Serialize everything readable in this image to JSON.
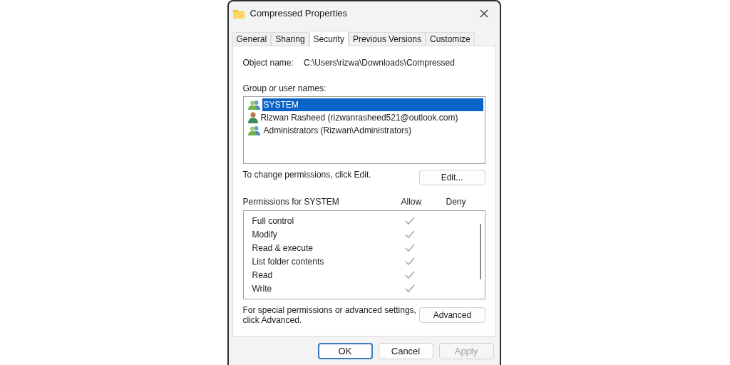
{
  "window": {
    "title": "Compressed Properties"
  },
  "tabs": [
    {
      "label": "General",
      "selected": false
    },
    {
      "label": "Sharing",
      "selected": false
    },
    {
      "label": "Security",
      "selected": true
    },
    {
      "label": "Previous Versions",
      "selected": false
    },
    {
      "label": "Customize",
      "selected": false
    }
  ],
  "object_name": {
    "label": "Object name:",
    "value": "C:\\Users\\rizwa\\Downloads\\Compressed"
  },
  "users": {
    "label": "Group or user names:",
    "items": [
      {
        "name": "SYSTEM",
        "kind": "group",
        "selected": true
      },
      {
        "name": "Rizwan Rasheed (rizwanrasheed521@outlook.com)",
        "kind": "user",
        "selected": false
      },
      {
        "name": "Administrators (Rizwan\\Administrators)",
        "kind": "group",
        "selected": false
      }
    ]
  },
  "edit_hint": "To change permissions, click Edit.",
  "edit_button": "Edit...",
  "permissions": {
    "label": "Permissions for SYSTEM",
    "allow_label": "Allow",
    "deny_label": "Deny",
    "rows": [
      {
        "name": "Full control",
        "allow": true
      },
      {
        "name": "Modify",
        "allow": true
      },
      {
        "name": "Read & execute",
        "allow": true
      },
      {
        "name": "List folder contents",
        "allow": true
      },
      {
        "name": "Read",
        "allow": true
      },
      {
        "name": "Write",
        "allow": true
      }
    ]
  },
  "advanced_hint": "For special permissions or advanced settings, click Advanced.",
  "advanced_button": "Advanced",
  "buttons": [
    {
      "label": "OK",
      "kind": "default",
      "disabled": false
    },
    {
      "label": "Cancel",
      "kind": "normal",
      "disabled": false
    },
    {
      "label": "Apply",
      "kind": "normal",
      "disabled": true
    }
  ]
}
